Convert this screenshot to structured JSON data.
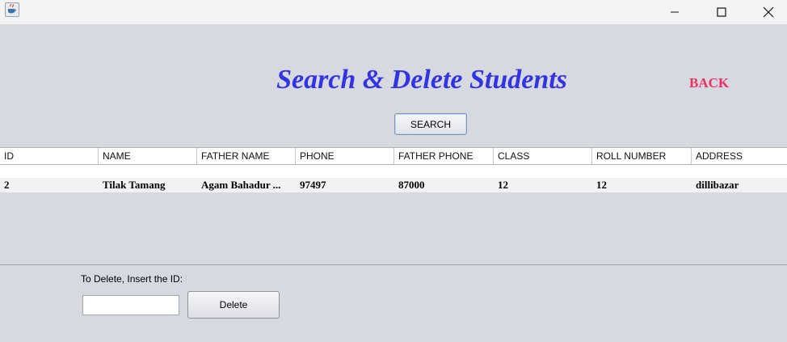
{
  "window": {
    "minimize_icon": "minimize-icon",
    "maximize_icon": "maximize-icon",
    "close_icon": "close-icon"
  },
  "header": {
    "title": "Search & Delete Students",
    "back_label": "BACK",
    "title_color": "#3333e6",
    "back_color": "#ee3060"
  },
  "search": {
    "button_label": "SEARCH"
  },
  "table": {
    "columns": [
      "ID",
      "NAME",
      "FATHER NAME",
      "PHONE",
      "FATHER PHONE",
      "CLASS",
      "ROLL NUMBER",
      "ADDRESS"
    ],
    "rows": [
      [
        "2",
        "Tilak Tamang",
        "Agam Bahadur ...",
        "97497",
        "87000",
        "12",
        "12",
        "dillibazar"
      ]
    ]
  },
  "delete": {
    "label": "To Delete, Insert the ID:",
    "input_value": "",
    "button_label": "Delete"
  }
}
